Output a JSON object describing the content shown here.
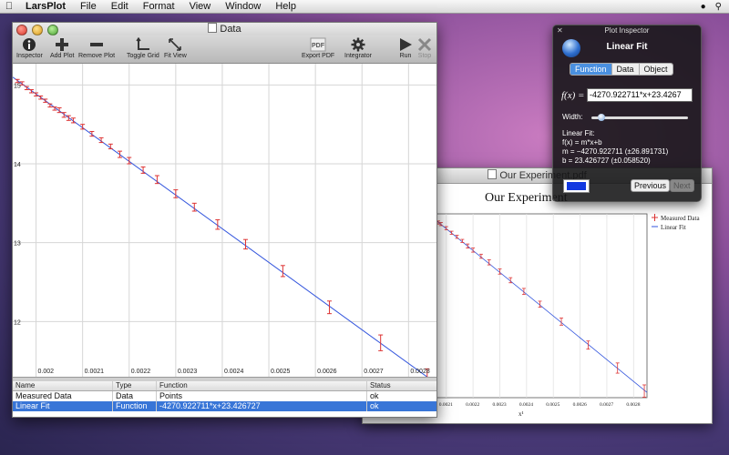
{
  "menubar": {
    "app_name": "LarsPlot",
    "menus": [
      "File",
      "Edit",
      "Format",
      "View",
      "Window",
      "Help"
    ]
  },
  "data_window": {
    "title": "Data",
    "toolbar": {
      "inspector": "Inspector",
      "add_plot": "Add Plot",
      "remove_plot": "Remove Plot",
      "toggle_grid": "Toggle Grid",
      "fit_view": "Fit View",
      "export_pdf": "Export PDF",
      "export_pdf_icon_text": "PDF",
      "integrator": "Integrator",
      "run": "Run",
      "stop": "Stop"
    },
    "table": {
      "headers": [
        "Name",
        "Type",
        "Function",
        "Status"
      ],
      "rows": [
        {
          "name": "Measured Data",
          "type": "Data",
          "function": "Points",
          "status": "ok",
          "selected": false
        },
        {
          "name": "Linear Fit",
          "type": "Function",
          "function": "-4270.922711*x+23.426727",
          "status": "ok",
          "selected": true
        }
      ]
    }
  },
  "paper_window": {
    "title": "Our Experiment.pdf",
    "plot_title": "Our Experiment",
    "legend": [
      "Measured Data",
      "Linear Fit"
    ],
    "x_label": "x¹",
    "x_ticks": [
      "0.0021",
      "0.0022",
      "0.0023",
      "0.0024",
      "0.0025",
      "0.0026",
      "0.0027",
      "0.0028"
    ]
  },
  "inspector": {
    "title": "Plot Inspector",
    "heading": "Linear Fit",
    "tabs": [
      "Function",
      "Data",
      "Object"
    ],
    "active_tab": "Function",
    "fx_label": "f(x) =",
    "fx_value": "-4270.922711*x+23.4267",
    "width_label": "Width:",
    "width_value": 0.1,
    "fit_heading": "Linear Fit:",
    "fit_formula": "f(x) = m*x+b",
    "fit_m": "m = −4270.922711 (±26.891731)",
    "fit_b": "b = 23.426727 (±0.058520)",
    "prev_button": "Previous",
    "next_button": "Next",
    "line_color": "#1238e0"
  },
  "colors": {
    "fit_line": "#3355dd",
    "error_bars": "#dd3333",
    "selection": "#3875d7"
  },
  "chart_data": [
    {
      "type": "scatter",
      "title": "",
      "xlim": [
        0.00195,
        0.00286
      ],
      "ylim": [
        11.6,
        15.2
      ],
      "x_ticks": [
        "0.002",
        "0.0021",
        "0.0022",
        "0.0023",
        "0.0024",
        "0.0025",
        "0.0026",
        "0.0027",
        "0.0028"
      ],
      "y_ticks": [
        "12",
        "13",
        "14",
        "15"
      ],
      "grid": true,
      "series": [
        {
          "x": [
            0.00196,
            0.00197,
            0.00198,
            0.00199,
            0.002,
            0.00201,
            0.00202,
            0.00203,
            0.00204,
            0.00205,
            0.00206,
            0.00207,
            0.00208,
            0.0021,
            0.00212,
            0.00214,
            0.00216,
            0.00218,
            0.0022,
            0.00223,
            0.00226,
            0.0023,
            0.00234,
            0.00239,
            0.00245,
            0.00253,
            0.00263,
            0.00274,
            0.00284
          ],
          "y": [
            15.05,
            15.02,
            14.96,
            14.92,
            14.88,
            14.84,
            14.8,
            14.74,
            14.7,
            14.68,
            14.62,
            14.58,
            14.55,
            14.47,
            14.38,
            14.3,
            14.22,
            14.12,
            14.04,
            13.92,
            13.8,
            13.62,
            13.45,
            13.23,
            12.98,
            12.64,
            12.18,
            11.73,
            11.28
          ],
          "err": [
            0.02,
            0.02,
            0.02,
            0.02,
            0.02,
            0.02,
            0.02,
            0.02,
            0.02,
            0.03,
            0.03,
            0.03,
            0.03,
            0.03,
            0.03,
            0.03,
            0.03,
            0.04,
            0.04,
            0.04,
            0.05,
            0.05,
            0.05,
            0.06,
            0.06,
            0.07,
            0.08,
            0.1,
            0.12
          ]
        },
        {
          "name": "",
          "kind": "line",
          "m": -4270.922711,
          "b": 23.426727
        }
      ]
    }
  ]
}
